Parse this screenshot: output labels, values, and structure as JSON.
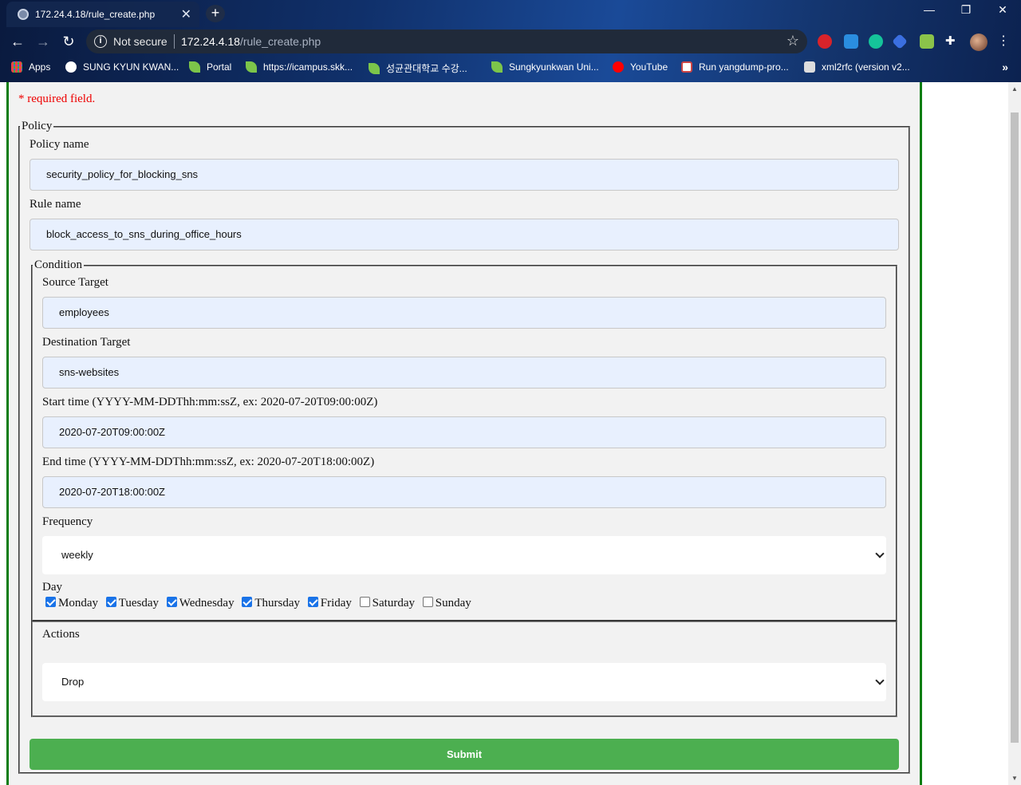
{
  "browser": {
    "tab_title": "172.24.4.18/rule_create.php",
    "not_secure": "Not secure",
    "url_host": "172.24.4.18",
    "url_path": "/rule_create.php",
    "bookmarks": [
      {
        "label": "Apps",
        "icon": "apps-grid-icon"
      },
      {
        "label": "SUNG KYUN KWAN...",
        "icon": "globe-icon"
      },
      {
        "label": "Portal",
        "icon": "leaf-icon"
      },
      {
        "label": "https://icampus.skk...",
        "icon": "leaf-icon"
      },
      {
        "label": "성균관대학교 수강...",
        "icon": "leaf-icon"
      },
      {
        "label": "Sungkyunkwan Uni...",
        "icon": "leaf-icon"
      },
      {
        "label": "YouTube",
        "icon": "youtube-icon"
      },
      {
        "label": "Run yangdump-pro...",
        "icon": "gear-icon"
      },
      {
        "label": "xml2rfc (version v2...",
        "icon": "xml2rfc-icon"
      }
    ],
    "more_bookmarks": "»"
  },
  "form": {
    "required_note": "* required field.",
    "policy_legend": "Policy",
    "policy_name_label": "Policy name",
    "policy_name_value": "security_policy_for_blocking_sns",
    "rule_name_label": "Rule name",
    "rule_name_value": "block_access_to_sns_during_office_hours",
    "condition_legend": "Condition",
    "source_label": "Source Target",
    "source_value": "employees",
    "destination_label": "Destination Target",
    "destination_value": "sns-websites",
    "start_label": "Start time (YYYY-MM-DDThh:mm:ssZ, ex: 2020-07-20T09:00:00Z)",
    "start_value": "2020-07-20T09:00:00Z",
    "end_label": "End time (YYYY-MM-DDThh:mm:ssZ, ex: 2020-07-20T18:00:00Z)",
    "end_value": "2020-07-20T18:00:00Z",
    "frequency_label": "Frequency",
    "frequency_value": "weekly",
    "day_label": "Day",
    "days": [
      {
        "label": "Monday",
        "checked": true
      },
      {
        "label": "Tuesday",
        "checked": true
      },
      {
        "label": "Wednesday",
        "checked": true
      },
      {
        "label": "Thursday",
        "checked": true
      },
      {
        "label": "Friday",
        "checked": true
      },
      {
        "label": "Saturday",
        "checked": false
      },
      {
        "label": "Sunday",
        "checked": false
      }
    ],
    "actions_label": "Actions",
    "action_value": "Drop",
    "submit_label": "Submit"
  },
  "colors": {
    "submit": "#4caf50",
    "border_accent": "#0a7d12",
    "required": "#e00000",
    "autofill": "#e8f0fe"
  }
}
